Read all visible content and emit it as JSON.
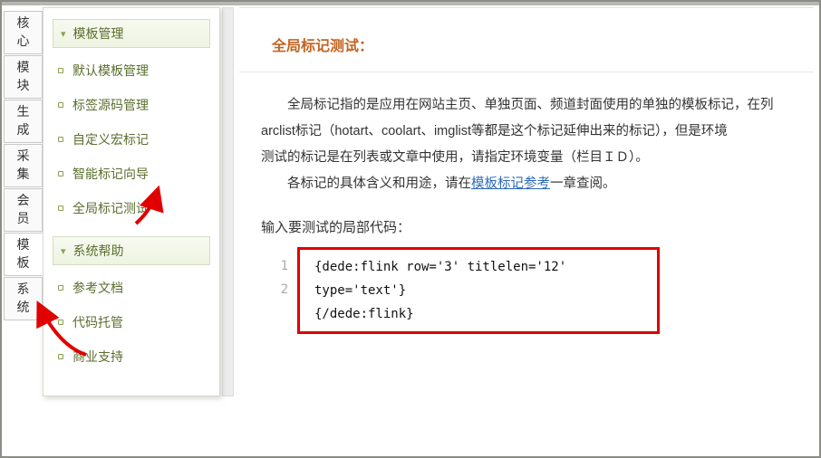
{
  "left_tabs": {
    "0": "核心",
    "1": "模块",
    "2": "生成",
    "3": "采集",
    "4": "会员",
    "5": "模板",
    "6": "系统"
  },
  "sidebar": {
    "header1": "模板管理",
    "items1": {
      "0": "默认模板管理",
      "1": "标签源码管理",
      "2": "自定义宏标记",
      "3": "智能标记向导",
      "4": "全局标记测试"
    },
    "header2": "系统帮助",
    "items2": {
      "0": "参考文档",
      "1": "代码托管",
      "2": "商业支持"
    }
  },
  "content": {
    "title": "全局标记测试：",
    "desc_line1_pre": "全局标记指的是应用在网站主页、单独页面、频道封面使用的单独的模板标记，在列",
    "desc_arc": "arclist标记（hotart、coolart、imglist等都是这个标记延伸出来的标记），但是环境",
    "desc_env": "测试的标记是在列表或文章中使用，请指定环境变量（栏目ＩＤ）。",
    "desc_line3_pre": "各标记的具体含义和用途，请在",
    "desc_link": "模板标记参考",
    "desc_line3_post": "一章查阅。",
    "code_label": "输入要测试的局部代码：",
    "code": {
      "num1": "1",
      "num2": "2",
      "line1": "{dede:flink  row='3' titlelen='12' type='text'}",
      "line2": "{/dede:flink}"
    }
  }
}
